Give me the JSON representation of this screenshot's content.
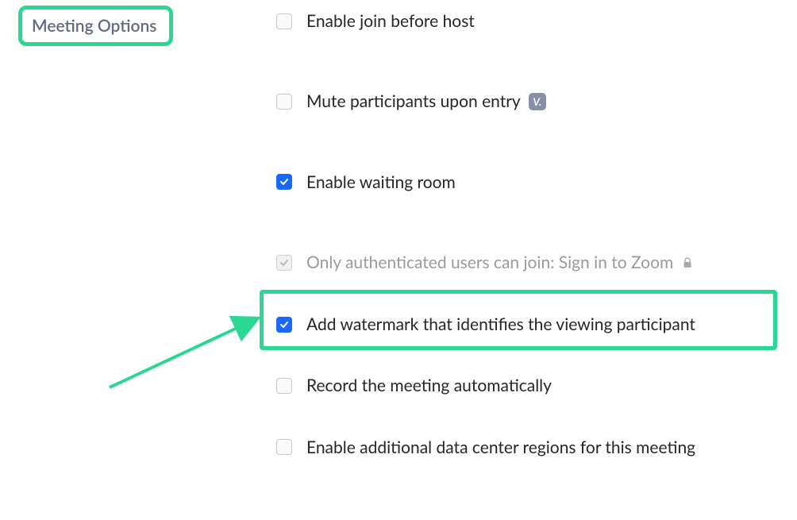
{
  "section": {
    "title": "Meeting Options"
  },
  "options": {
    "join_before_host": "Enable join before host",
    "mute_on_entry": "Mute participants upon entry",
    "waiting_room": "Enable waiting room",
    "auth_only": "Only authenticated users can join: Sign in to Zoom",
    "watermark": "Add watermark that identifies the viewing participant",
    "auto_record": "Record the meeting automatically",
    "extra_regions": "Enable additional data center regions for this meeting"
  },
  "annotations": {
    "highlight_color": "#2ad793"
  }
}
